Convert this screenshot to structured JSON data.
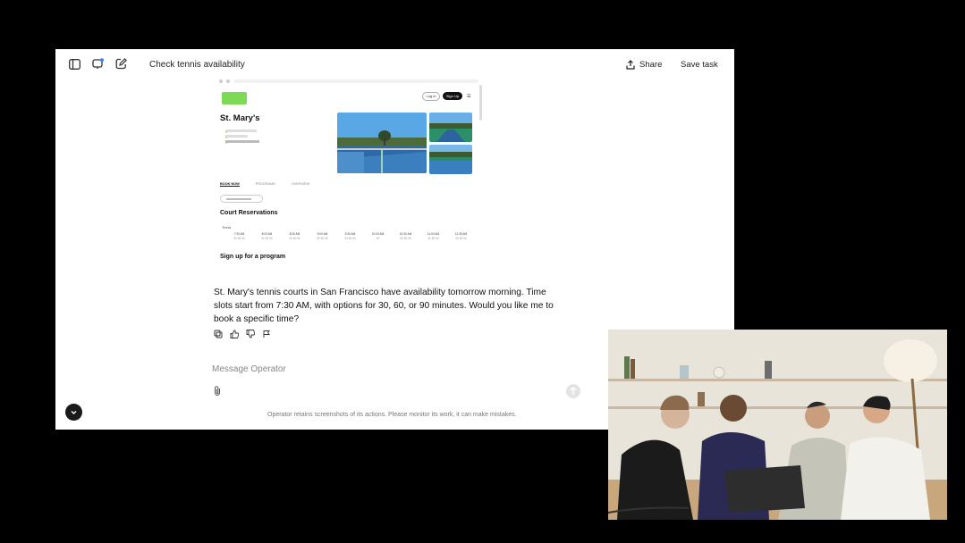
{
  "topbar": {
    "title": "Check tennis availability",
    "share_label": "Share",
    "save_label": "Save task"
  },
  "browser": {
    "login_label": "Log in",
    "signup_label": "Sign Up",
    "park_name": "St. Mary's",
    "tabs": [
      "BOOK NOW",
      "PROGRAMS",
      "OVERVIEW"
    ],
    "court_reservations_heading": "Court Reservations",
    "tennis_label": "Tennis",
    "time_slots": [
      {
        "time": "7:30 AM",
        "durations": "30 60 90"
      },
      {
        "time": "8:00 AM",
        "durations": "30 60 90"
      },
      {
        "time": "8:30 AM",
        "durations": "30 60 90"
      },
      {
        "time": "9:00 AM",
        "durations": "30 60 90"
      },
      {
        "time": "9:30 AM",
        "durations": "30 60 90"
      },
      {
        "time": "10:00 AM",
        "durations": "30"
      },
      {
        "time": "10:30 AM",
        "durations": "30 60 90"
      },
      {
        "time": "11:00 AM",
        "durations": "30 60 90"
      },
      {
        "time": "11:30 AM",
        "durations": "30 60 90"
      }
    ],
    "program_heading": "Sign up for a program"
  },
  "chat": {
    "answer": "St. Mary's tennis courts in San Francisco have availability tomorrow morning. Time slots start from 7:30 AM, with options for 30, 60, or 90 minutes. Would you like me to book a specific time?",
    "message_placeholder": "Message Operator",
    "disclaimer": "Operator retains screenshots of its actions. Please monitor its work, it can make mistakes."
  },
  "colors": {
    "accent_green": "#7ed957",
    "court_blue": "#2f6aa8",
    "app_bg": "#ffffff"
  }
}
